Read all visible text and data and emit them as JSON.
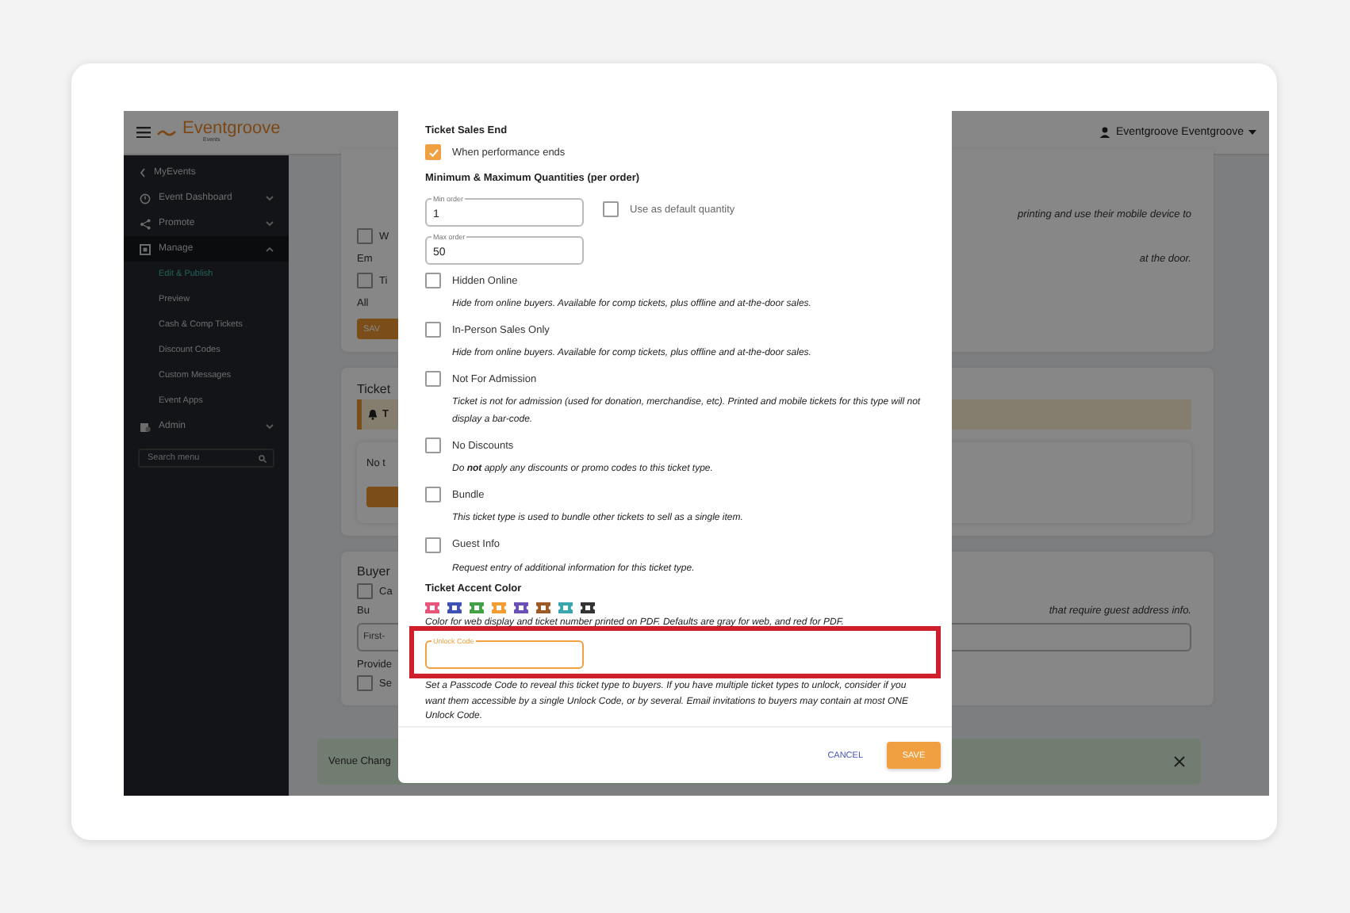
{
  "app_header": {
    "logo": "Eventgroove",
    "logo_sub": "Events",
    "user": "Eventgroove Eventgroove"
  },
  "sidebar": {
    "back": "MyEvents",
    "items": [
      {
        "label": "Event Dashboard",
        "expanded": false
      },
      {
        "label": "Promote",
        "expanded": false
      },
      {
        "label": "Manage",
        "expanded": true,
        "children": [
          {
            "label": "Edit & Publish",
            "selected": true
          },
          {
            "label": "Preview",
            "selected": false
          },
          {
            "label": "Cash & Comp Tickets",
            "selected": false
          },
          {
            "label": "Discount Codes",
            "selected": false
          },
          {
            "label": "Custom Messages",
            "selected": false
          },
          {
            "label": "Event Apps",
            "selected": false
          }
        ]
      },
      {
        "label": "Admin",
        "expanded": false
      }
    ],
    "search": {
      "placeholder": "Search menu"
    }
  },
  "background_page": {
    "cards": [
      {
        "rows": [
          {
            "kind": "text",
            "right": "printing and use their mobile device to"
          },
          {
            "kind": "checkbox",
            "left": "W",
            "checked": false
          },
          {
            "kind": "text",
            "left": "Em",
            "right": "at the door."
          },
          {
            "kind": "checkbox",
            "left": "Ti",
            "checked": false
          },
          {
            "kind": "text",
            "left": "All"
          },
          {
            "kind": "button",
            "left": "SAV"
          }
        ]
      },
      {
        "rows": [
          {
            "kind": "heading",
            "left": "Ticket"
          },
          {
            "kind": "alert",
            "left": "T"
          },
          {
            "kind": "panel",
            "left": "No t"
          }
        ]
      },
      {
        "rows": [
          {
            "kind": "heading",
            "left": "Buyer"
          },
          {
            "kind": "checkbox",
            "left": "Ca",
            "checked": false
          },
          {
            "kind": "text",
            "left": "Bu",
            "right": "that require guest address info."
          },
          {
            "kind": "field",
            "left": "First-"
          },
          {
            "kind": "text",
            "left": "Provide"
          },
          {
            "kind": "checkbox",
            "left": "Se",
            "checked": false
          }
        ]
      }
    ]
  },
  "toast": {
    "text": "Venue Chang"
  },
  "modal": {
    "sales_end": {
      "title": "Ticket Sales End",
      "option": {
        "label": "When performance ends",
        "checked": true
      }
    },
    "quantities": {
      "title": "Minimum & Maximum Quantities (per order)",
      "min": {
        "label": "Min order",
        "value": "1"
      },
      "default_option": {
        "label": "Use as default quantity",
        "checked": false
      },
      "max": {
        "label": "Max order",
        "value": "50"
      }
    },
    "options": [
      {
        "label": "Hidden Online",
        "description": "Hide from online buyers. Available for comp tickets, plus offline and at-the-door sales.",
        "checked": false
      },
      {
        "label": "In-Person Sales Only",
        "description": "Hide from online buyers. Available for comp tickets, plus offline and at-the-door sales.",
        "checked": false
      },
      {
        "label": "Not For Admission",
        "description": "Ticket is not for admission (used for donation, merchandise, etc). Printed and mobile tickets for this type will not display a bar-code.",
        "checked": false
      },
      {
        "label": "No Discounts",
        "description": "Do **not** apply any discounts or promo codes to this ticket type.",
        "checked": false
      },
      {
        "label": "Bundle",
        "description": "This ticket type is used to bundle other tickets to sell as a single item.",
        "checked": false
      },
      {
        "label": "Guest Info",
        "description": "Request entry of additional information for this ticket type.",
        "checked": false
      }
    ],
    "accent_color": {
      "title": "Ticket Accent Color",
      "swatches": [
        {
          "color": "#e8557a"
        },
        {
          "color": "#3f51b5"
        },
        {
          "color": "#43a047"
        },
        {
          "color": "#f39c33"
        },
        {
          "color": "#6a4fb6"
        },
        {
          "color": "#9c5a26"
        },
        {
          "color": "#3aa6b0"
        },
        {
          "color": "#333333"
        }
      ],
      "description": "Color for web display and ticket number printed on PDF. Defaults are gray for web, and red for PDF."
    },
    "unlock_code": {
      "label": "Unlock Code",
      "focused": true,
      "highlighted": true,
      "description": "Set a Passcode Code to reveal this ticket type to buyers. If you have multiple ticket types to unlock, consider if you want them accessible by a single Unlock Code, or by several. Email invitations to buyers may contain at most ONE Unlock Code."
    },
    "buttons": [
      {
        "label": "CANCEL",
        "kind": "text"
      },
      {
        "label": "SAVE",
        "kind": "primary"
      }
    ]
  }
}
